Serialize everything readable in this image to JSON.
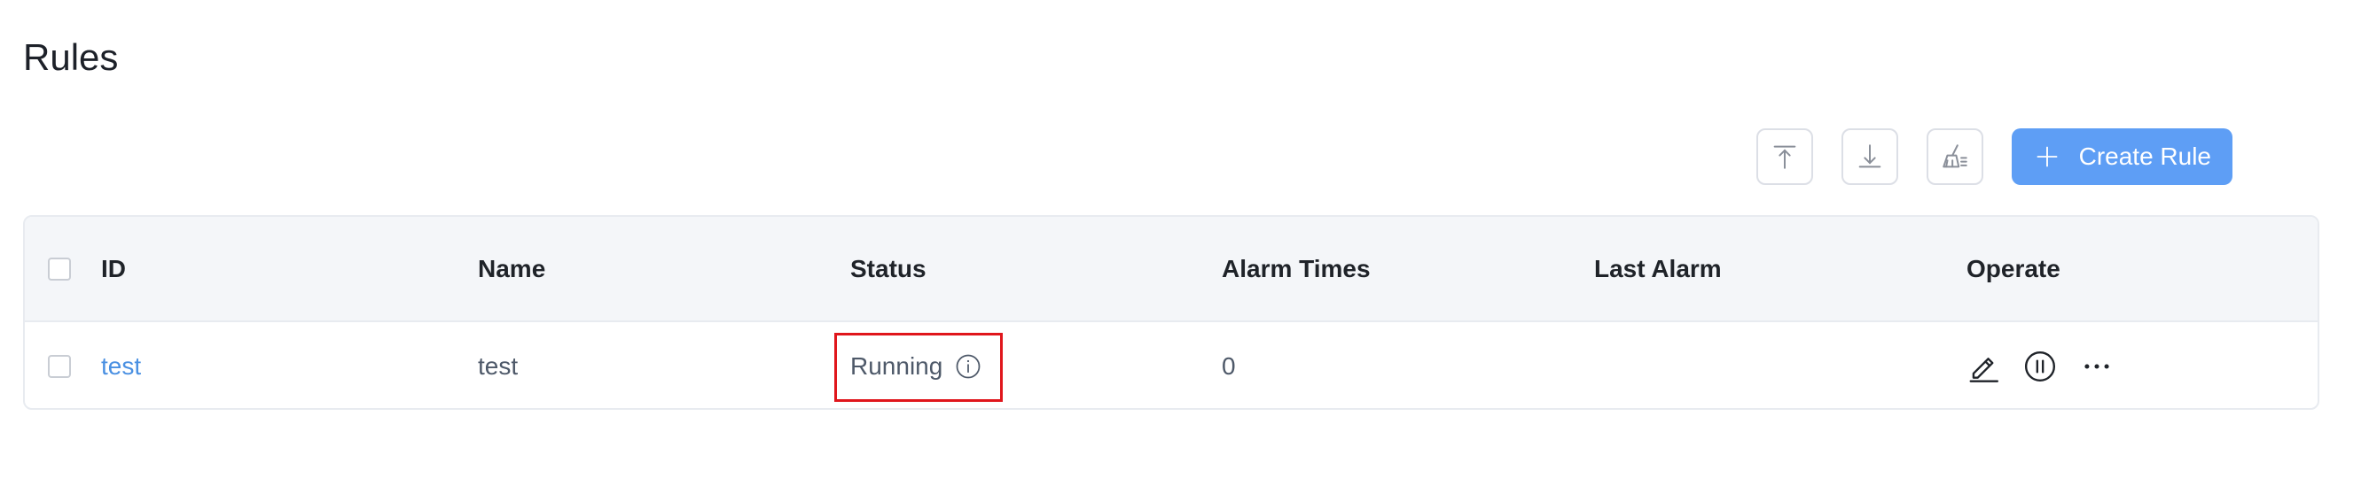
{
  "page": {
    "title": "Rules"
  },
  "toolbar": {
    "upload_icon": "upload-icon",
    "download_icon": "download-icon",
    "clean_icon": "broom-icon",
    "create_label": "Create Rule",
    "create_icon": "plus-icon"
  },
  "table": {
    "columns": [
      "ID",
      "Name",
      "Status",
      "Alarm Times",
      "Last Alarm",
      "Operate"
    ],
    "rows": [
      {
        "id": "test",
        "name": "test",
        "status": "Running",
        "alarm_times": "0",
        "last_alarm": "",
        "operate_icons": [
          "edit-icon",
          "pause-icon",
          "more-icon"
        ]
      }
    ]
  },
  "colors": {
    "accent": "#5e9ef5",
    "link": "#4a90e2",
    "highlight": "#e0161c",
    "header_bg": "#f4f6f9"
  }
}
